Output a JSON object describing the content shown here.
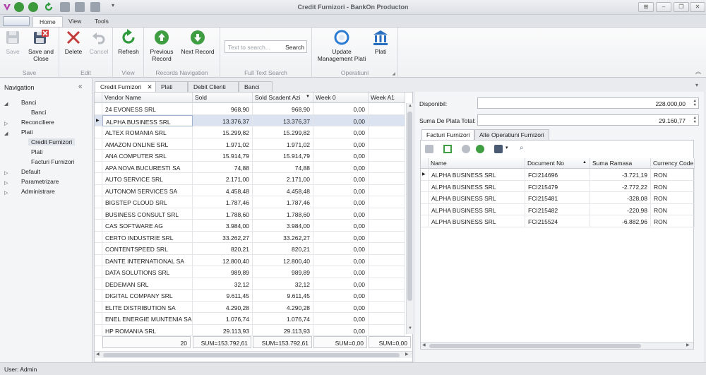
{
  "window": {
    "title": "Credit Furnizori - BankOn Producton"
  },
  "ribbon_tabs": [
    "Home",
    "View",
    "Tools"
  ],
  "ribbon": {
    "save": "Save",
    "save_close": [
      "Save and",
      "Close"
    ],
    "group_save": "Save",
    "delete": "Delete",
    "cancel": "Cancel",
    "group_edit": "Edit",
    "refresh": "Refresh",
    "group_view": "View",
    "previous_record": [
      "Previous",
      "Record"
    ],
    "next_record": "Next Record",
    "group_records_navigation": "Records Navigation",
    "search_placeholder": "Text to search...",
    "search_button": "Search",
    "group_full_text_search": "Full Text Search",
    "update_management_plati": [
      "Update",
      "Management Plati"
    ],
    "plati": "Plati",
    "group_operatiuni": "Operatiuni"
  },
  "navigation": {
    "header": "Navigation",
    "items": [
      {
        "label": "Banci",
        "level": 0,
        "expanded": true
      },
      {
        "label": "Banci",
        "level": 1
      },
      {
        "label": "Reconciliere",
        "level": 0,
        "expanded": false
      },
      {
        "label": "Plati",
        "level": 0,
        "expanded": true
      },
      {
        "label": "Credit Furnizori",
        "level": 1,
        "selected": true
      },
      {
        "label": "Plati",
        "level": 1
      },
      {
        "label": "Facturi Furnizori",
        "level": 1
      },
      {
        "label": "Default",
        "level": 0,
        "expanded": false
      },
      {
        "label": "Parametrizare",
        "level": 0,
        "expanded": false
      },
      {
        "label": "Administrare",
        "level": 0,
        "expanded": false
      }
    ]
  },
  "doc_tabs": [
    "Credit Furnizori",
    "Plati",
    "Debit Clienti",
    "Banci"
  ],
  "grid": {
    "columns": [
      "Vendor Name",
      "Sold",
      "Sold Scadent Azi",
      "Week 0",
      "Week A1"
    ],
    "rows": [
      [
        "24 EVONESS SRL",
        "968,90",
        "968,90",
        "0,00"
      ],
      [
        "ALPHA BUSINESS SRL",
        "13.376,37",
        "13.376,37",
        "0,00"
      ],
      [
        "ALTEX ROMANIA SRL",
        "15.299,82",
        "15.299,82",
        "0,00"
      ],
      [
        "AMAZON ONLINE SRL",
        "1.971,02",
        "1.971,02",
        "0,00"
      ],
      [
        "ANA COMPUTER SRL",
        "15.914,79",
        "15.914,79",
        "0,00"
      ],
      [
        "APA NOVA BUCURESTI SA",
        "74,88",
        "74,88",
        "0,00"
      ],
      [
        "AUTO SERVICE SRL",
        "2.171,00",
        "2.171,00",
        "0,00"
      ],
      [
        "AUTONOM SERVICES SA",
        "4.458,48",
        "4.458,48",
        "0,00"
      ],
      [
        "BIGSTEP CLOUD SRL",
        "1.787,46",
        "1.787,46",
        "0,00"
      ],
      [
        "BUSINESS CONSULT SRL",
        "1.788,60",
        "1.788,60",
        "0,00"
      ],
      [
        "CAS SOFTWARE AG",
        "3.984,00",
        "3.984,00",
        "0,00"
      ],
      [
        "CERTO INDUSTRIE SRL",
        "33.262,27",
        "33.262,27",
        "0,00"
      ],
      [
        "CONTENTSPEED SRL",
        "820,21",
        "820,21",
        "0,00"
      ],
      [
        "DANTE INTERNATIONAL SA",
        "12.800,40",
        "12.800,40",
        "0,00"
      ],
      [
        "DATA SOLUTIONS SRL",
        "989,89",
        "989,89",
        "0,00"
      ],
      [
        "DEDEMAN SRL",
        "32,12",
        "32,12",
        "0,00"
      ],
      [
        "DIGITAL COMPANY SRL",
        "9.611,45",
        "9.611,45",
        "0,00"
      ],
      [
        "ELITE DISTRIBUTION SA",
        "4.290,28",
        "4.290,28",
        "0,00"
      ],
      [
        "ENEL ENERGIE MUNTENIA SA",
        "1.076,74",
        "1.076,74",
        "0,00"
      ],
      [
        "HP ROMANIA SRL",
        "29.113,93",
        "29.113,93",
        "0,00"
      ]
    ],
    "selected_row": 1,
    "footer": [
      "20",
      "SUM=153.792,61",
      "SUM=153.792,61",
      "SUM=0,00",
      "SUM=0,00"
    ]
  },
  "right": {
    "disponibil_label": "Disponibil:",
    "disponibil_value": "228.000,00",
    "suma_label": "Suma De Plata Total:",
    "suma_value": "29.160,77",
    "tabs": [
      "Facturi Furnizori",
      "Alte Operatiuni Furnizori"
    ],
    "columns": [
      "Name",
      "Document No",
      "Suma Ramasa",
      "Currency Code"
    ],
    "rows": [
      [
        "ALPHA BUSINESS SRL",
        "FCI214696",
        "-3.721,19",
        "RON"
      ],
      [
        "ALPHA BUSINESS SRL",
        "FCI215479",
        "-2.772,22",
        "RON"
      ],
      [
        "ALPHA BUSINESS SRL",
        "FCI215481",
        "-328,08",
        "RON"
      ],
      [
        "ALPHA BUSINESS SRL",
        "FCI215482",
        "-220,98",
        "RON"
      ],
      [
        "ALPHA BUSINESS SRL",
        "FCI215524",
        "-6.882,96",
        "RON"
      ]
    ]
  },
  "status": {
    "user": "User: Admin"
  },
  "colors": {
    "accent": "#2b7bd3",
    "green": "#2f9a3c",
    "red": "#c33a3a"
  }
}
